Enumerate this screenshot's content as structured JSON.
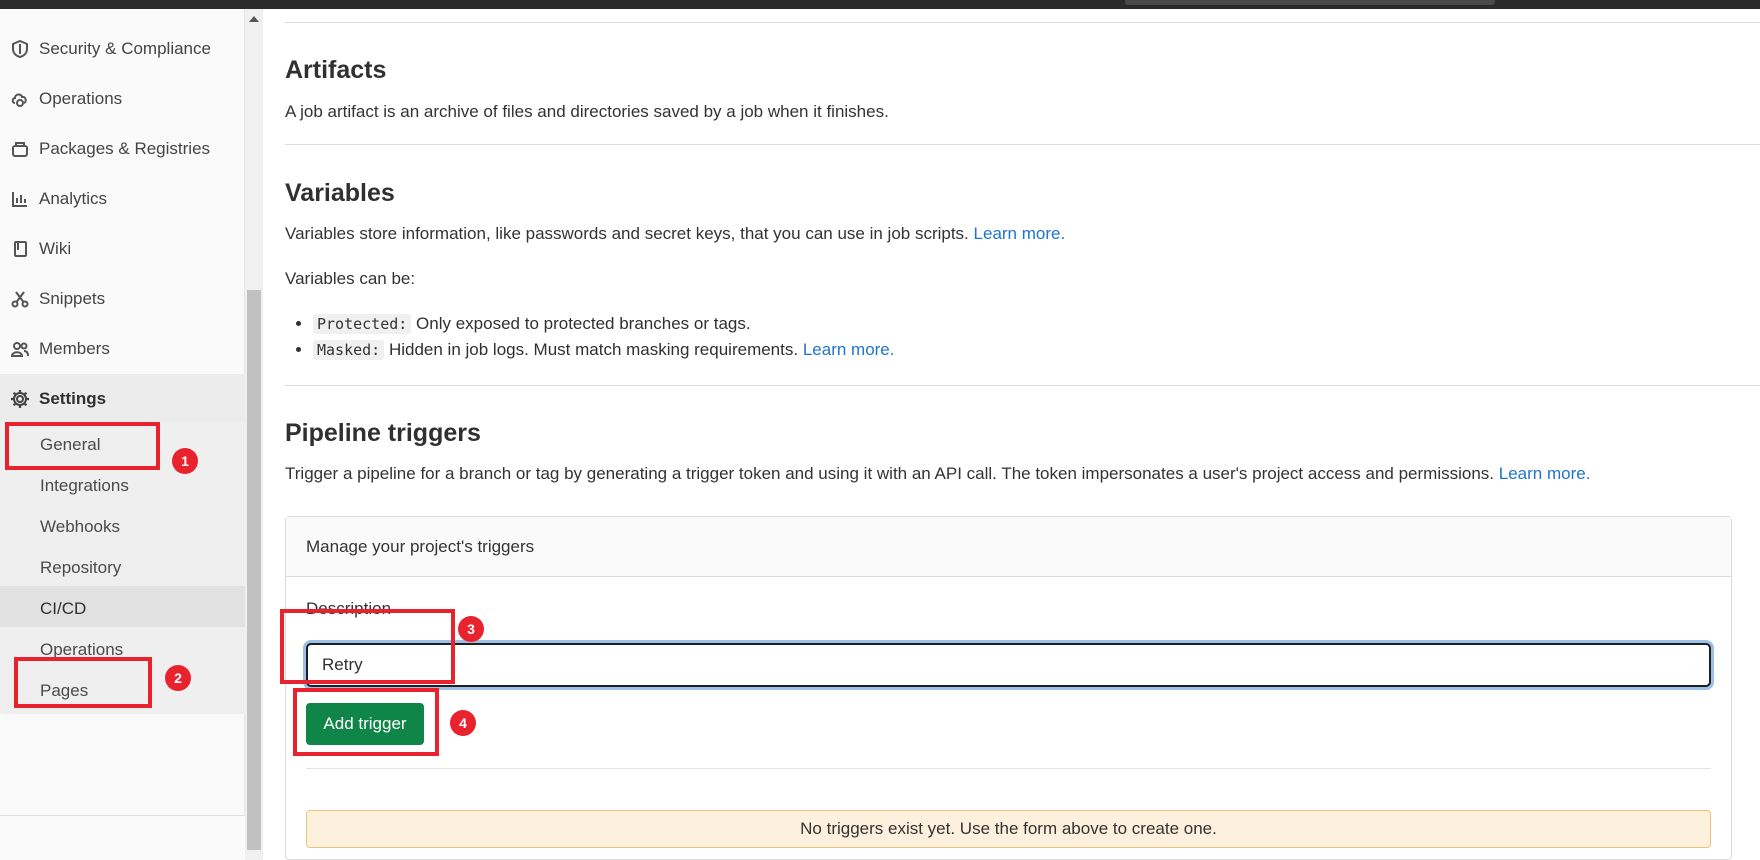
{
  "sidebar": {
    "items": [
      {
        "label": "Security & Compliance",
        "icon": "shield-icon"
      },
      {
        "label": "Operations",
        "icon": "cloud-gear-icon"
      },
      {
        "label": "Packages & Registries",
        "icon": "package-icon"
      },
      {
        "label": "Analytics",
        "icon": "chart-icon"
      },
      {
        "label": "Wiki",
        "icon": "book-icon"
      },
      {
        "label": "Snippets",
        "icon": "scissors-icon"
      },
      {
        "label": "Members",
        "icon": "users-icon"
      },
      {
        "label": "Settings",
        "icon": "gear-icon"
      }
    ],
    "settings_sub": [
      "General",
      "Integrations",
      "Webhooks",
      "Repository",
      "CI/CD",
      "Operations",
      "Pages"
    ]
  },
  "artifacts": {
    "title": "Artifacts",
    "desc": "A job artifact is an archive of files and directories saved by a job when it finishes."
  },
  "variables": {
    "title": "Variables",
    "desc": "Variables store information, like passwords and secret keys, that you can use in job scripts.",
    "learn_more": "Learn more.",
    "can_be": "Variables can be:",
    "protected_code": "Protected:",
    "protected_text": "Only exposed to protected branches or tags.",
    "masked_code": "Masked:",
    "masked_text": "Hidden in job logs. Must match masking requirements.",
    "masked_learn_more": "Learn more."
  },
  "triggers": {
    "title": "Pipeline triggers",
    "desc": "Trigger a pipeline for a branch or tag by generating a trigger token and using it with an API call. The token impersonates a user's project access and permissions.",
    "learn_more": "Learn more.",
    "card_header": "Manage your project's triggers",
    "description_label": "Description",
    "description_value": "Retry",
    "add_button": "Add trigger",
    "empty_alert": "No triggers exist yet. Use the form above to create one."
  },
  "annotations": [
    "1",
    "2",
    "3",
    "4"
  ],
  "colors": {
    "accent_link": "#1f75cb",
    "button_green": "#108548",
    "annotation_red": "#e8232e",
    "alert_bg": "#fdf1dd"
  }
}
